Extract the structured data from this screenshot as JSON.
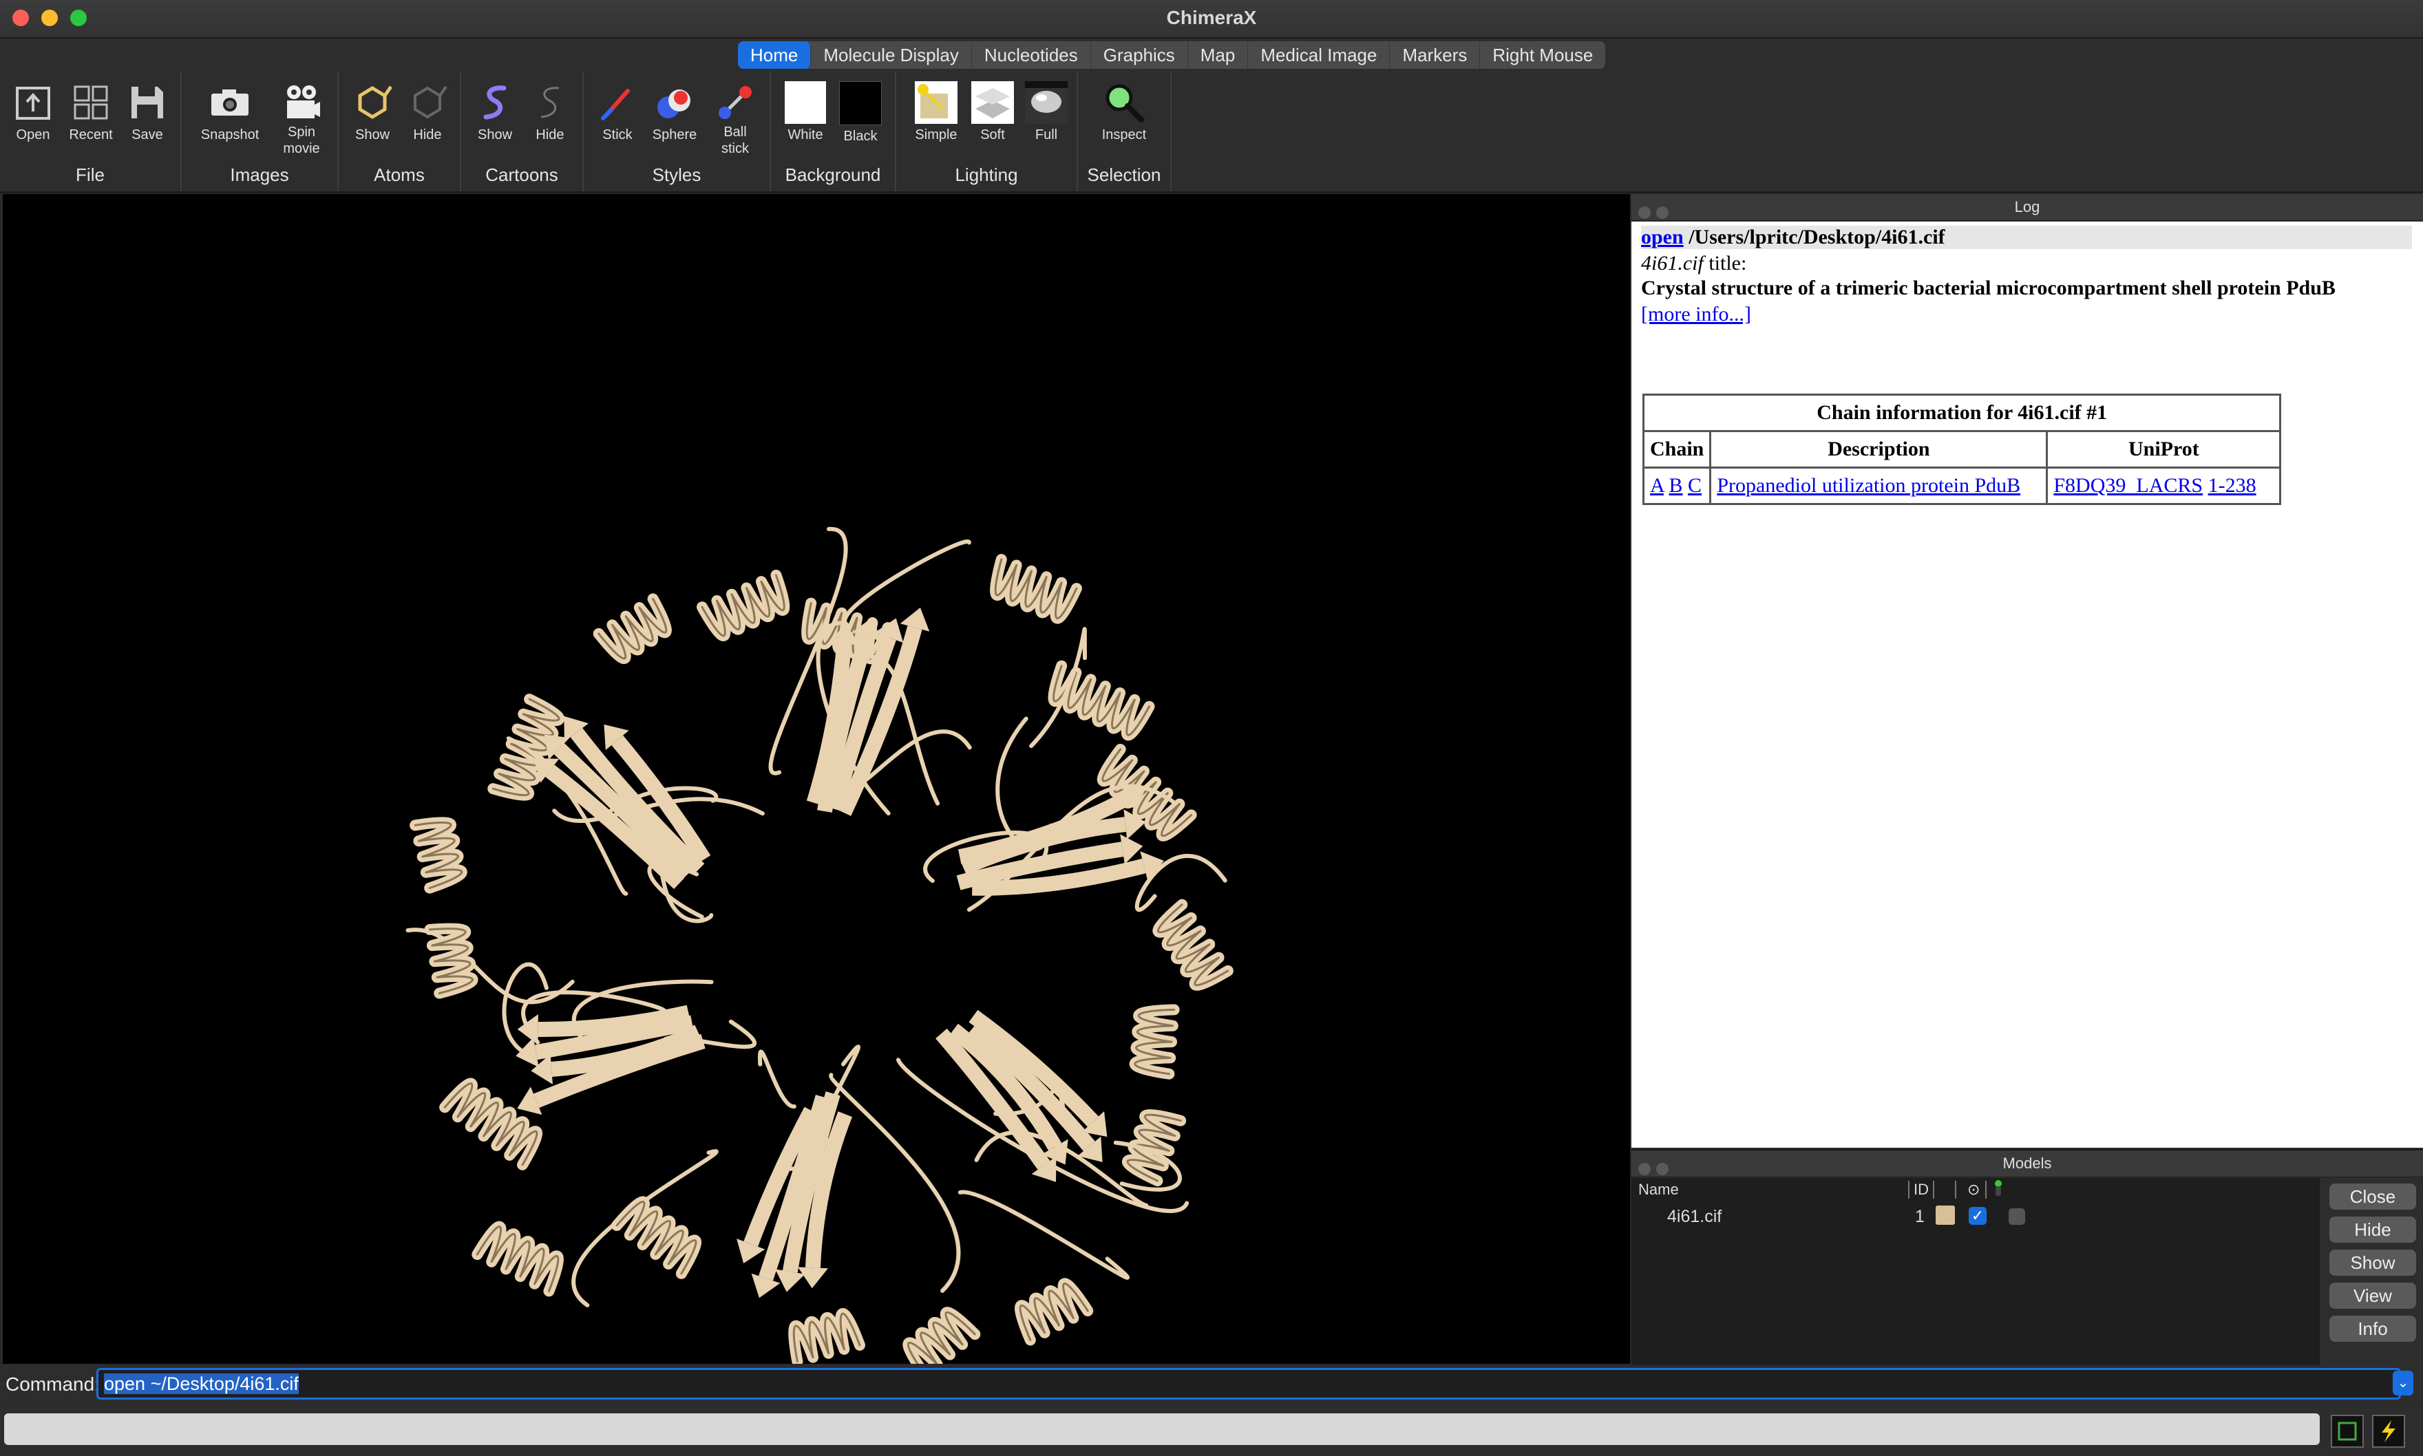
{
  "window": {
    "title": "ChimeraX"
  },
  "tabs": [
    "Home",
    "Molecule Display",
    "Nucleotides",
    "Graphics",
    "Map",
    "Medical Image",
    "Markers",
    "Right Mouse"
  ],
  "toolbar": {
    "file": {
      "label": "File",
      "open": "Open",
      "recent": "Recent",
      "save": "Save"
    },
    "images": {
      "label": "Images",
      "snapshot": "Snapshot",
      "spin1": "Spin",
      "spin2": "movie"
    },
    "atoms": {
      "label": "Atoms",
      "show": "Show",
      "hide": "Hide"
    },
    "cartoons": {
      "label": "Cartoons",
      "show": "Show",
      "hide": "Hide"
    },
    "styles": {
      "label": "Styles",
      "stick": "Stick",
      "sphere": "Sphere",
      "ball1": "Ball",
      "ball2": "stick"
    },
    "background": {
      "label": "Background",
      "white": "White",
      "black": "Black"
    },
    "lighting": {
      "label": "Lighting",
      "simple": "Simple",
      "soft": "Soft",
      "full": "Full"
    },
    "selection": {
      "label": "Selection",
      "inspect": "Inspect"
    }
  },
  "log": {
    "header": "Log",
    "cmd_link": "open",
    "cmd_path": " /Users/lpritc/Desktop/4i61.cif",
    "file_name": "4i61.cif",
    "title_suffix": " title:",
    "structure_title": "Crystal structure of a trimeric bacterial microcompartment shell protein PduB",
    "more_info": "[more info...]",
    "table": {
      "caption": "Chain information for 4i61.cif #1",
      "headers": [
        "Chain",
        "Description",
        "UniProt"
      ],
      "chains": [
        "A",
        "B",
        "C"
      ],
      "description": "Propanediol utilization protein PduB",
      "uniprot": "F8DQ39_LACRS",
      "range": "1-238"
    }
  },
  "models": {
    "header": "Models",
    "columns": {
      "name": "Name",
      "id": "ID"
    },
    "rows": [
      {
        "name": "4i61.cif",
        "id": "1",
        "color": "#d9bf95"
      }
    ],
    "buttons": [
      "Close",
      "Hide",
      "Show",
      "View",
      "Info"
    ]
  },
  "command": {
    "label": "Command:",
    "value": "open ~/Desktop/4i61.cif"
  },
  "colors": {
    "accent": "#1a6fe0",
    "ribbon": "#e8d2b0",
    "bg": "#2d2d2d"
  }
}
